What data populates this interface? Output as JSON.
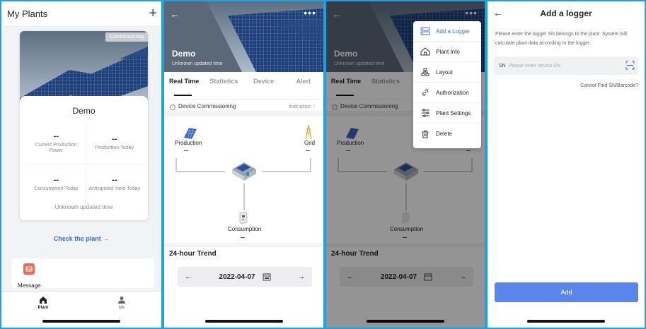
{
  "screen1": {
    "title": "My Plants",
    "add_icon": "+",
    "card": {
      "tag": "Commissioning",
      "name": "Demo",
      "kpis": [
        {
          "value": "--",
          "label": "Current Production Power"
        },
        {
          "value": "--",
          "label": "Production-Today"
        },
        {
          "value": "--",
          "label": "Consumption-Today"
        },
        {
          "value": "--",
          "label": "Anticipated Yield-Today"
        }
      ],
      "updated": "Unknown updated time"
    },
    "check_link": "Check the plant →",
    "message_label": "Message",
    "tabs": [
      {
        "label": "Plant",
        "icon": "home-icon"
      },
      {
        "label": "Me",
        "icon": "person-icon"
      }
    ]
  },
  "screen2": {
    "back": "←",
    "more": "•••",
    "name": "Demo",
    "updated": "Unknown updated time",
    "tabs": [
      "Real Time",
      "Statistics",
      "Device",
      "Alert"
    ],
    "commissioning": {
      "text": "Device Commissioning",
      "link": "Instruction"
    },
    "flow": {
      "production": {
        "label": "Production",
        "value": "--"
      },
      "grid": {
        "label": "Grid",
        "value": "--"
      },
      "consumption": {
        "label": "Consumption",
        "value": "--"
      }
    },
    "trend_title": "24-hour Trend",
    "date": "2022-04-07"
  },
  "screen3": {
    "menu": [
      {
        "label": "Add a Logger",
        "icon": "logger-icon"
      },
      {
        "label": "Plant Info",
        "icon": "house-icon"
      },
      {
        "label": "Layout",
        "icon": "layout-icon"
      },
      {
        "label": "Authorization",
        "icon": "link-icon"
      },
      {
        "label": "Plant Settings",
        "icon": "settings-icon"
      },
      {
        "label": "Delete",
        "icon": "trash-icon"
      }
    ]
  },
  "screen4": {
    "back": "←",
    "title": "Add a logger",
    "description": "Please enter the logger SN belongs to the plant. System will calculate plant data according to the logger.",
    "sn_label": "SN",
    "sn_placeholder": "Please enter device SN",
    "cannot_find": "Cannot Find SN/Barcode?",
    "add_button": "Add"
  },
  "colors": {
    "accent": "#3b6cd9",
    "button": "#5b86e9",
    "frame": "#1aa3e0"
  }
}
